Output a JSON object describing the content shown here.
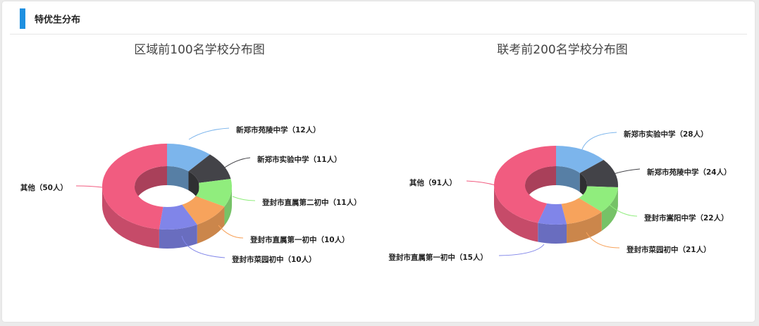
{
  "section": {
    "title": "特优生分布",
    "accent_color": "#1e90e0"
  },
  "chart_data": [
    {
      "type": "pie",
      "title": "区域前100名学校分布图",
      "categories": [
        "新郑市苑陵中学",
        "新郑市实验中学",
        "登封市直属第二初中",
        "登封市直属第一初中",
        "登封市菜园初中",
        "其他"
      ],
      "values": [
        12,
        11,
        11,
        10,
        10,
        50
      ],
      "labels": [
        "新郑市苑陵中学（12人）",
        "新郑市实验中学（11人）",
        "登封市直属第二初中（11人）",
        "登封市直属第一初中（10人）",
        "登封市菜园初中（10人）",
        "其他（50人）"
      ],
      "colors": [
        "#7cb5ec",
        "#434348",
        "#90ed7d",
        "#f7a35c",
        "#8085e9",
        "#f15c80"
      ]
    },
    {
      "type": "pie",
      "title": "联考前200名学校分布图",
      "categories": [
        "新郑市实验中学",
        "新郑市苑陵中学",
        "登封市嵩阳中学",
        "登封市菜园初中",
        "登封市直属第一初中",
        "其他"
      ],
      "values": [
        28,
        24,
        22,
        21,
        15,
        91
      ],
      "labels": [
        "新郑市实验中学（28人）",
        "新郑市苑陵中学（24人）",
        "登封市嵩阳中学（22人）",
        "登封市菜园初中（21人）",
        "登封市直属第一初中（15人）",
        "其他（91人）"
      ],
      "colors": [
        "#7cb5ec",
        "#434348",
        "#90ed7d",
        "#f7a35c",
        "#8085e9",
        "#f15c80"
      ]
    }
  ]
}
